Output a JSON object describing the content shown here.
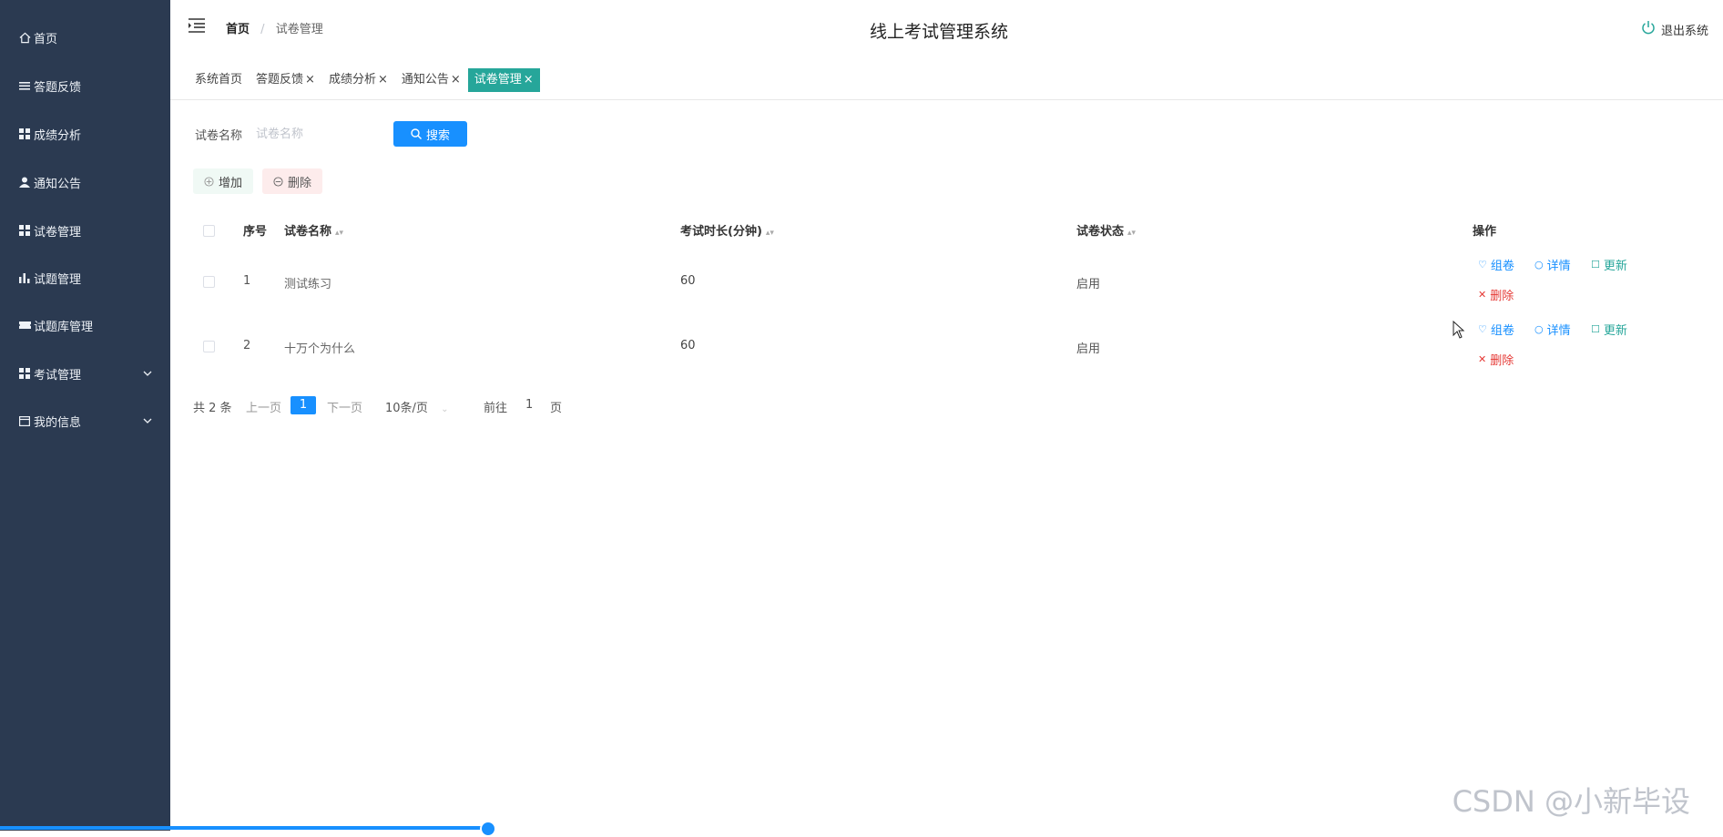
{
  "sidebar": {
    "items": [
      {
        "label": "首页",
        "icon": "home-icon"
      },
      {
        "label": "答题反馈",
        "icon": "list-icon"
      },
      {
        "label": "成绩分析",
        "icon": "grid-icon"
      },
      {
        "label": "通知公告",
        "icon": "user-icon"
      },
      {
        "label": "试卷管理",
        "icon": "grid-icon"
      },
      {
        "label": "试题管理",
        "icon": "bar-chart-icon"
      },
      {
        "label": "试题库管理",
        "icon": "ticket-icon"
      },
      {
        "label": "考试管理",
        "icon": "grid-icon"
      },
      {
        "label": "我的信息",
        "icon": "calendar-icon"
      }
    ]
  },
  "header": {
    "breadcrumb_home": "首页",
    "breadcrumb_sep": "/",
    "breadcrumb_current": "试卷管理",
    "title": "线上考试管理系统",
    "logout": "退出系统"
  },
  "tabs": [
    {
      "label": "系统首页",
      "closable": false
    },
    {
      "label": "答题反馈",
      "closable": true
    },
    {
      "label": "成绩分析",
      "closable": true
    },
    {
      "label": "通知公告",
      "closable": true
    },
    {
      "label": "试卷管理",
      "closable": true,
      "active": true
    }
  ],
  "tab_close": "×",
  "search": {
    "label": "试卷名称",
    "placeholder": "试卷名称",
    "button": "搜索"
  },
  "actions": {
    "add": "增加",
    "delete": "删除"
  },
  "table": {
    "columns": [
      "序号",
      "试卷名称",
      "考试时长(分钟)",
      "试卷状态",
      "操作"
    ],
    "rows": [
      {
        "index": "1",
        "name": "测试练习",
        "duration": "60",
        "status": "启用"
      },
      {
        "index": "2",
        "name": "十万个为什么",
        "duration": "60",
        "status": "启用"
      }
    ],
    "ops": {
      "compose": "组卷",
      "detail": "详情",
      "update": "更新",
      "delete": "删除"
    }
  },
  "pagination": {
    "total": "共 2 条",
    "prev": "上一页",
    "current": "1",
    "next": "下一页",
    "page_size": "10条/页",
    "goto_prefix": "前往",
    "goto_value": "1",
    "goto_suffix": "页"
  },
  "watermark": "CSDN @小新毕设",
  "progress": 0.28,
  "colors": {
    "sidebar": "#2b3a51",
    "accent": "#1890ff",
    "tab_active": "#26a69a",
    "danger": "#e53935"
  }
}
